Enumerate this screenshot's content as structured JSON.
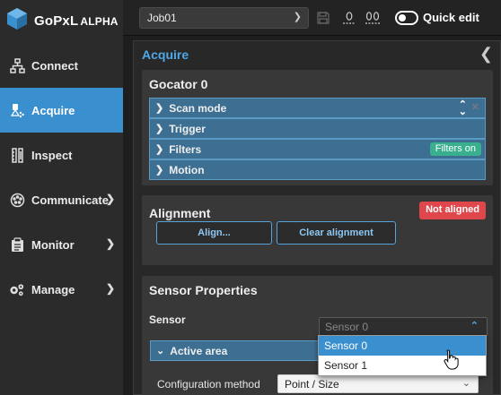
{
  "app": {
    "logo_text": "GoPxL",
    "logo_sub": "ALPHA"
  },
  "sidebar": {
    "items": [
      {
        "label": "Connect",
        "icon": "network-icon",
        "active": false,
        "has_chevron": false
      },
      {
        "label": "Acquire",
        "icon": "acquire-icon",
        "active": true,
        "has_chevron": false
      },
      {
        "label": "Inspect",
        "icon": "inspect-icon",
        "active": false,
        "has_chevron": false
      },
      {
        "label": "Communicate",
        "icon": "communicate-icon",
        "active": false,
        "has_chevron": true
      },
      {
        "label": "Monitor",
        "icon": "monitor-icon",
        "active": false,
        "has_chevron": true
      },
      {
        "label": "Manage",
        "icon": "gears-icon",
        "active": false,
        "has_chevron": true
      }
    ]
  },
  "toolbar": {
    "job_value": "Job01",
    "icon_save": "save-icon",
    "icon_zero_a": "zero-icon",
    "icon_zero_b": "zero-zero-icon",
    "quick_edit_label": "Quick edit",
    "quick_edit_on": false
  },
  "main": {
    "title": "Acquire",
    "gocator": {
      "title": "Gocator 0",
      "rows": [
        {
          "label": "Scan mode"
        },
        {
          "label": "Trigger"
        },
        {
          "label": "Filters",
          "badge": "Filters on"
        },
        {
          "label": "Motion"
        }
      ]
    },
    "alignment": {
      "title": "Alignment",
      "status": "Not aligned",
      "align_button": "Align...",
      "clear_button": "Clear alignment"
    },
    "sensor_props": {
      "title": "Sensor Properties",
      "sensor_label": "Sensor",
      "sensor_value": "Sensor 0",
      "active_area_label": "Active area",
      "config_method_label": "Configuration method",
      "config_method_value": "Point / Size"
    }
  },
  "dropdown": {
    "options": [
      "Sensor 0",
      "Sensor 1"
    ],
    "selected": "Sensor 0"
  },
  "colors": {
    "accent": "#3a8fce",
    "title_blue": "#4ea9e8",
    "accordion": "#3d6f92",
    "badge_green": "#3aaf8e",
    "badge_red": "#e0474c"
  }
}
